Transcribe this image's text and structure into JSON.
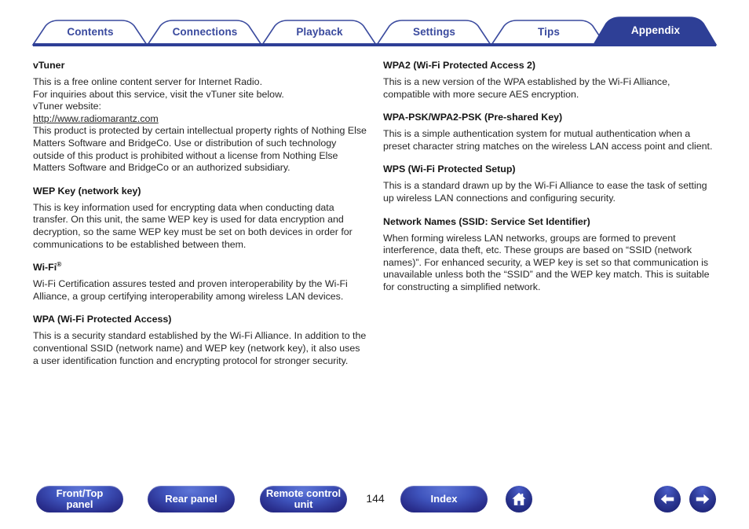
{
  "tabs": [
    {
      "label": "Contents",
      "active": false
    },
    {
      "label": "Connections",
      "active": false
    },
    {
      "label": "Playback",
      "active": false
    },
    {
      "label": "Settings",
      "active": false
    },
    {
      "label": "Tips",
      "active": false
    },
    {
      "label": "Appendix",
      "active": true
    }
  ],
  "colors": {
    "brand_blue": "#2e3f96",
    "tab_text": "#3a4a9e",
    "active_tab_text": "#ffffff",
    "body_text": "#262626"
  },
  "left_column": {
    "sections": [
      {
        "heading": "vTuner",
        "line1": "This is a free online content server for Internet Radio.",
        "line2": "For inquiries about this service, visit the vTuner site below.",
        "line3": "vTuner website:",
        "url": "http://www.radiomarantz.com",
        "paragraph": "This product is protected by certain intellectual property rights of Nothing Else Matters Software and BridgeCo. Use or distribution of such technology outside of this product is prohibited without a license from Nothing Else Matters Software and BridgeCo or an authorized subsidiary."
      },
      {
        "heading": "WEP Key (network key)",
        "paragraph": "This is key information used for encrypting data when conducting data transfer. On this unit, the same WEP key is used for data encryption and decryption, so the same WEP key must be set on both devices in order for communications to be established between them."
      },
      {
        "heading": "Wi-Fi",
        "heading_sup": "®",
        "paragraph": "Wi-Fi Certification assures tested and proven interoperability by the Wi-Fi Alliance, a group certifying interoperability among wireless LAN devices."
      },
      {
        "heading": "WPA (Wi-Fi Protected Access)",
        "paragraph": "This is a security standard established by the Wi-Fi Alliance. In addition to the conventional SSID (network name) and WEP key (network key), it also uses a user identification function and encrypting protocol for stronger security."
      }
    ]
  },
  "right_column": {
    "sections": [
      {
        "heading": "WPA2 (Wi-Fi Protected Access 2)",
        "paragraph": "This is a new version of the WPA established by the Wi-Fi Alliance, compatible with more secure AES encryption."
      },
      {
        "heading": "WPA-PSK/WPA2-PSK (Pre-shared Key)",
        "paragraph": "This is a simple authentication system for mutual authentication when a preset character string matches on the wireless LAN access point and client."
      },
      {
        "heading": "WPS (Wi-Fi Protected Setup)",
        "paragraph": "This is a standard drawn up by the Wi-Fi Alliance to ease the task of setting up wireless LAN connections and configuring security."
      },
      {
        "heading": "Network Names (SSID: Service Set Identifier)",
        "paragraph": "When forming wireless LAN networks, groups are formed to prevent interference, data theft, etc. These groups are based on “SSID (network names)”. For enhanced security, a WEP key is set so that communication is unavailable unless both the “SSID” and the WEP key match. This is suitable for constructing a simplified network."
      }
    ]
  },
  "footer": {
    "front_top_panel_line1": "Front/Top",
    "front_top_panel_line2": "panel",
    "rear_panel": "Rear panel",
    "remote_line1": "Remote control",
    "remote_line2": "unit",
    "index": "Index",
    "page_number": "144",
    "home_icon": "home-icon",
    "prev_icon": "arrow-left-icon",
    "next_icon": "arrow-right-icon"
  }
}
